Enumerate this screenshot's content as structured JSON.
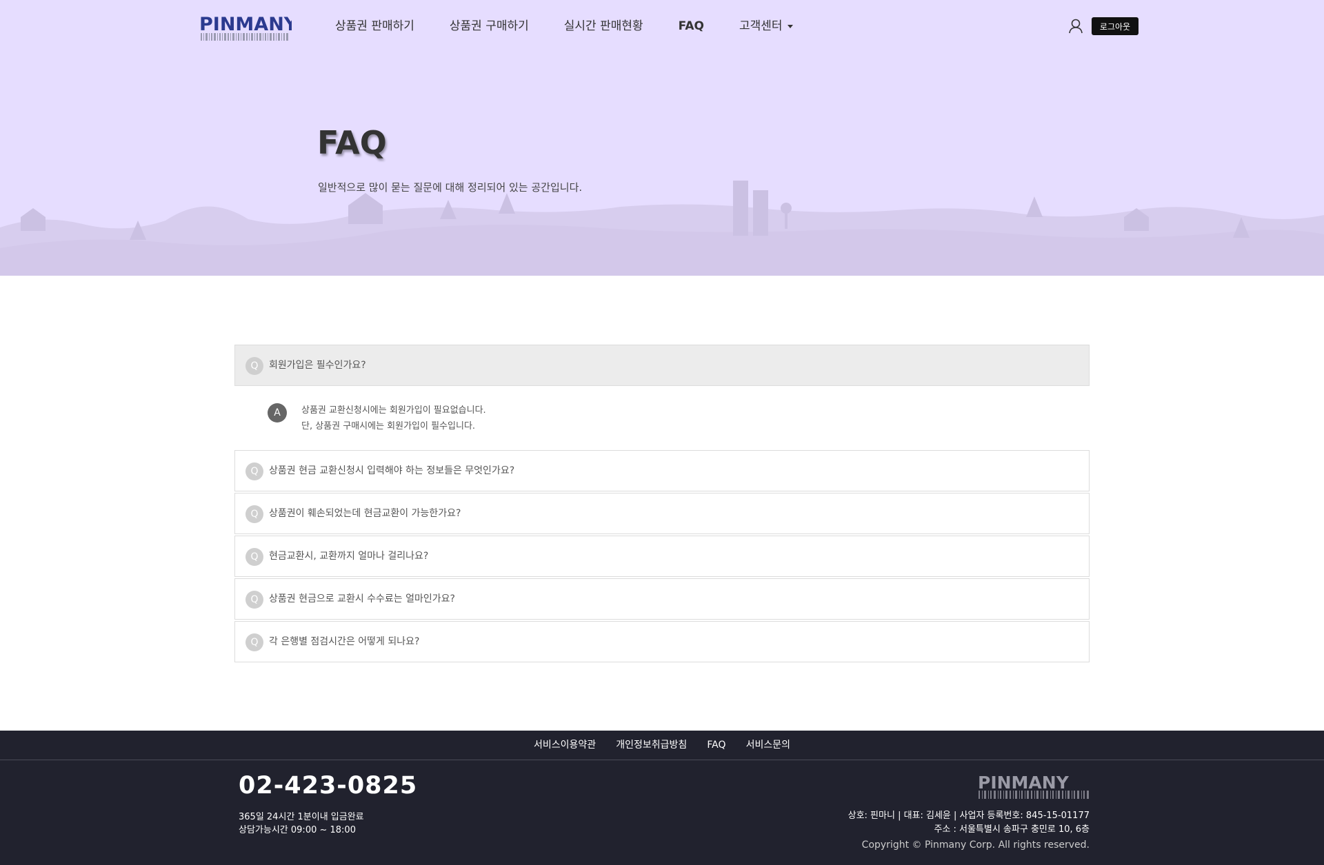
{
  "header": {
    "brand": "PINMANY",
    "nav": [
      {
        "label": "상품권 판매하기"
      },
      {
        "label": "상품권 구매하기"
      },
      {
        "label": "실시간 판매현황"
      },
      {
        "label": "FAQ"
      },
      {
        "label": "고객센터"
      }
    ],
    "user_icon": "user-icon",
    "logout_label": "로그아웃"
  },
  "hero": {
    "title": "FAQ",
    "subtitle": "일반적으로 많이 묻는 질문에 대해 정리되어 있는 공간입니다.",
    "background_color": "#e6ddff"
  },
  "faq": {
    "q_badge": "Q",
    "a_badge": "A",
    "items": [
      {
        "question": "회원가입은 필수인가요?",
        "answer_line1": "상품권 교환신청시에는 회원가입이 필요없습니다.",
        "answer_line2": "단, 상품권 구매시에는 회원가입이 필수입니다."
      },
      {
        "question": "상품권 현금 교환신청시 입력해야 하는 정보들은 무엇인가요?"
      },
      {
        "question": "상품권이 훼손되었는데 현금교환이 가능한가요?"
      },
      {
        "question": "현금교환시, 교환까지 얼마나 걸리나요?"
      },
      {
        "question": "상품권 현금으로 교환시 수수료는 얼마인가요?"
      },
      {
        "question": "각 은행별 점검시간은 어떻게 되나요?"
      }
    ]
  },
  "footer": {
    "links": [
      "서비스이용약관",
      "개인정보취급방침",
      "FAQ",
      "서비스문의"
    ],
    "phone": "02-423-0825",
    "hours_line1": "365일 24시간 1분이내 입금완료",
    "hours_line2": "상담가능시간 09:00 ~ 18:00",
    "brand": "PINMANY",
    "company_line1": "상호: 핀마니 | 대표: 김세윤 | 사업자 등록번호: 845-15-01177",
    "company_line2": "주소 : 서울특별시 송파구 충민로 10, 6층",
    "copyright": "Copyright © Pinmany Corp. All rights reserved.",
    "background_color": "#21222e"
  }
}
